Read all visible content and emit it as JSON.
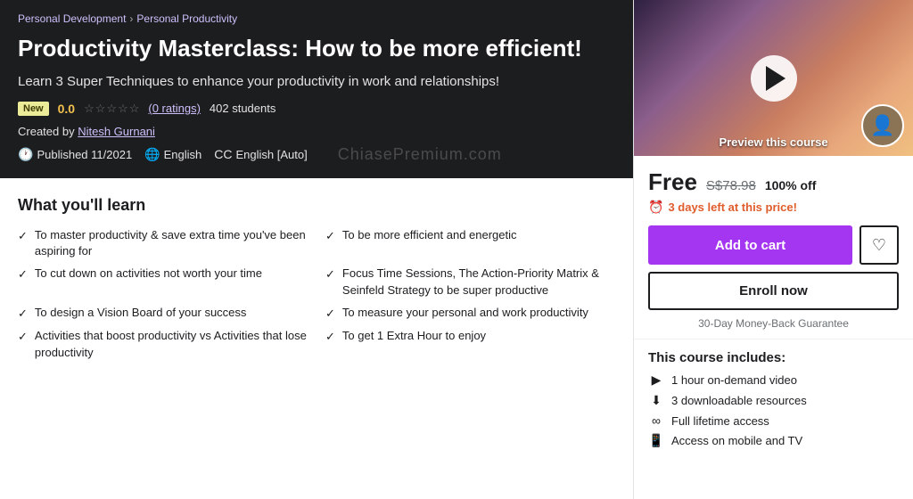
{
  "breadcrumb": {
    "parent": "Personal Development",
    "current": "Personal Productivity",
    "separator": "›"
  },
  "course": {
    "title": "Productivity Masterclass: How to be more efficient!",
    "subtitle": "Learn 3 Super Techniques to enhance your productivity in work and relationships!",
    "badge": "New",
    "rating_score": "0.0",
    "rating_count": "(0 ratings)",
    "students": "402 students",
    "author_label": "Created by",
    "author_name": "Nitesh Gurnani",
    "published_label": "Published 11/2021",
    "language": "English",
    "captions": "English [Auto]"
  },
  "watermark": "ChiasePremium.com",
  "learn": {
    "title": "What you'll learn",
    "items_left": [
      "To master productivity & save extra time you've been aspiring for",
      "To cut down on activities not worth your time",
      "To design a Vision Board of your success",
      "Activities that boost productivity vs Activities that lose productivity"
    ],
    "items_right": [
      "To be more efficient and energetic",
      "Focus Time Sessions, The Action-Priority Matrix & Seinfeld Strategy to be super productive",
      "To measure your personal and work productivity",
      "To get 1 Extra Hour to enjoy"
    ]
  },
  "preview": {
    "label": "Preview this course"
  },
  "pricing": {
    "free_label": "Free",
    "original_price": "S$78.98",
    "discount_pct": "100% off",
    "urgency_days": "3 days left at this price!",
    "add_to_cart": "Add to cart",
    "enroll_now": "Enroll now",
    "money_back": "30-Day Money-Back Guarantee"
  },
  "includes": {
    "title": "This course includes:",
    "items": [
      {
        "icon": "▶",
        "text": "1 hour on-demand video"
      },
      {
        "icon": "⬇",
        "text": "3 downloadable resources"
      },
      {
        "icon": "∞",
        "text": "Full lifetime access"
      },
      {
        "icon": "📱",
        "text": "Access on mobile and TV"
      }
    ]
  }
}
